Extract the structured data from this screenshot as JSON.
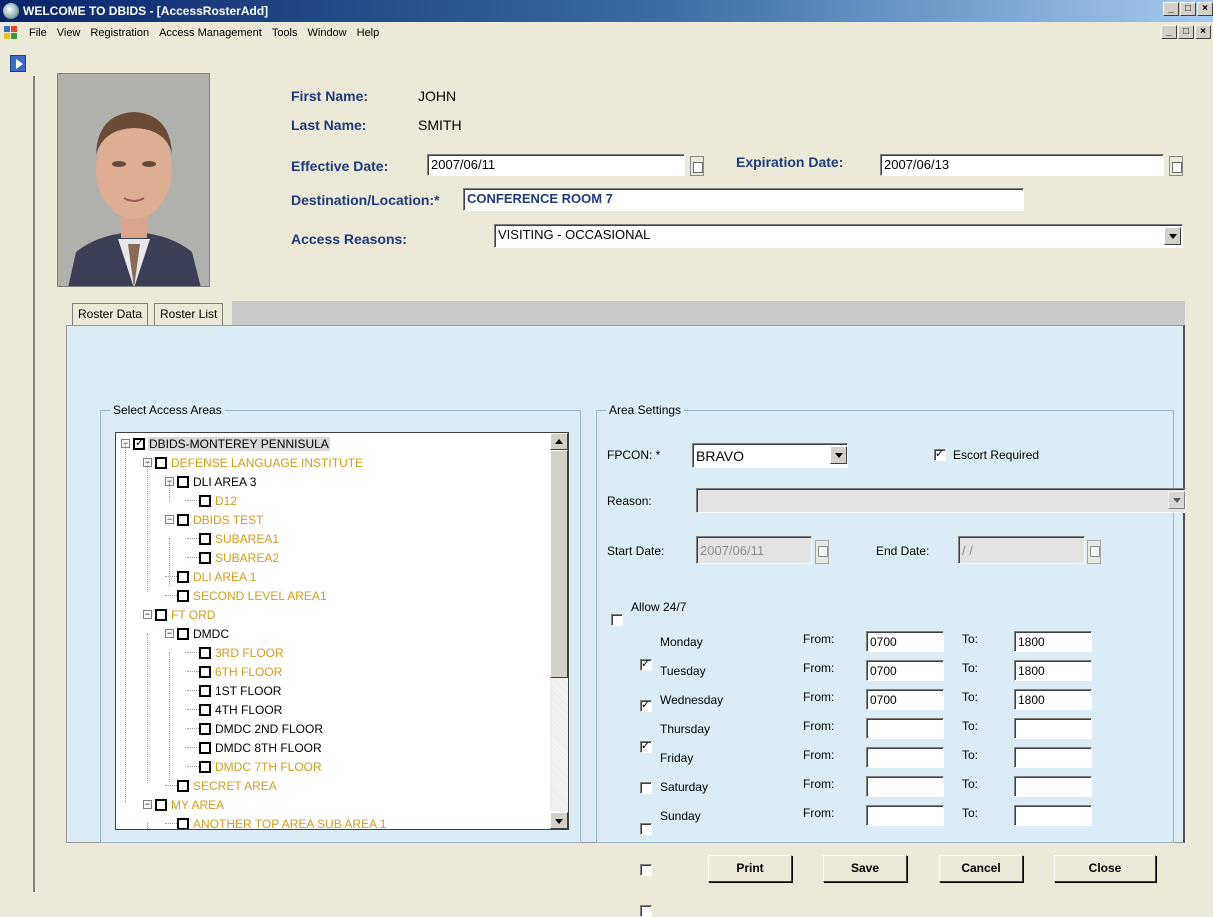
{
  "window": {
    "title": "WELCOME TO DBIDS - [AccessRosterAdd]",
    "controls": [
      "_",
      "□",
      "×"
    ]
  },
  "menu": {
    "items": [
      "File",
      "View",
      "Registration",
      "Access Management",
      "Tools",
      "Window",
      "Help"
    ]
  },
  "person": {
    "first_name_label": "First Name:",
    "first_name": "JOHN",
    "last_name_label": "Last Name:",
    "last_name": "SMITH"
  },
  "form": {
    "effective_date_label": "Effective Date:",
    "effective_date": "2007/06/11",
    "expiration_date_label": "Expiration Date:",
    "expiration_date": "2007/06/13",
    "destination_label": "Destination/Location:*",
    "destination": "CONFERENCE ROOM 7",
    "access_reasons_label": "Access Reasons:",
    "access_reason": "VISITING - OCCASIONAL"
  },
  "tabs": [
    "Roster Data",
    "Roster List"
  ],
  "tree_group_title": "Select Access Areas",
  "tree": [
    {
      "label": "DBIDS-MONTEREY PENNISULA",
      "level": 0,
      "checked": true,
      "expander": "−",
      "gold": false
    },
    {
      "label": "DEFENSE LANGUAGE INSTITUTE",
      "level": 1,
      "checked": false,
      "expander": "−",
      "gold": true
    },
    {
      "label": "DLI AREA 3",
      "level": 2,
      "checked": false,
      "expander": "−",
      "gold": false
    },
    {
      "label": "D12",
      "level": 3,
      "checked": false,
      "expander": "",
      "gold": true
    },
    {
      "label": "DBIDS TEST",
      "level": 2,
      "checked": false,
      "expander": "−",
      "gold": true
    },
    {
      "label": "SUBAREA1",
      "level": 3,
      "checked": false,
      "expander": "",
      "gold": true
    },
    {
      "label": "SUBAREA2",
      "level": 3,
      "checked": false,
      "expander": "",
      "gold": true
    },
    {
      "label": "DLI AREA 1",
      "level": 2,
      "checked": false,
      "expander": "",
      "gold": true
    },
    {
      "label": "SECOND LEVEL AREA1",
      "level": 2,
      "checked": false,
      "expander": "",
      "gold": true
    },
    {
      "label": "FT ORD",
      "level": 1,
      "checked": false,
      "expander": "−",
      "gold": true
    },
    {
      "label": "DMDC",
      "level": 2,
      "checked": false,
      "expander": "−",
      "gold": false
    },
    {
      "label": "3RD FLOOR",
      "level": 3,
      "checked": false,
      "expander": "",
      "gold": true
    },
    {
      "label": "6TH FLOOR",
      "level": 3,
      "checked": false,
      "expander": "",
      "gold": true
    },
    {
      "label": "1ST FLOOR",
      "level": 3,
      "checked": false,
      "expander": "",
      "gold": false
    },
    {
      "label": "4TH FLOOR",
      "level": 3,
      "checked": false,
      "expander": "",
      "gold": false
    },
    {
      "label": "DMDC 2ND FLOOR",
      "level": 3,
      "checked": false,
      "expander": "",
      "gold": false
    },
    {
      "label": "DMDC 8TH FLOOR",
      "level": 3,
      "checked": false,
      "expander": "",
      "gold": false
    },
    {
      "label": "DMDC 7TH FLOOR",
      "level": 3,
      "checked": false,
      "expander": "",
      "gold": true
    },
    {
      "label": "SECRET AREA",
      "level": 2,
      "checked": false,
      "expander": "",
      "gold": true
    },
    {
      "label": "MY AREA",
      "level": 1,
      "checked": false,
      "expander": "−",
      "gold": true
    },
    {
      "label": "ANOTHER TOP AREA SUB AREA 1",
      "level": 2,
      "checked": false,
      "expander": "",
      "gold": true
    }
  ],
  "settings": {
    "group_title": "Area Settings",
    "fpcon_label": "FPCON: *",
    "fpcon_value": "BRAVO",
    "escort_label": "Escort Required",
    "escort_checked": true,
    "reason_label": "Reason:",
    "reason_value": "",
    "start_date_label": "Start Date:",
    "start_date": "2007/06/11",
    "end_date_label": "End Date:",
    "end_date": " /  /",
    "allow247_label": "Allow 24/7",
    "allow247_checked": false,
    "from_label": "From:",
    "to_label": "To:"
  },
  "schedule": [
    {
      "day": "Monday",
      "checked": true,
      "from": "0700",
      "to": "1800"
    },
    {
      "day": "Tuesday",
      "checked": true,
      "from": "0700",
      "to": "1800"
    },
    {
      "day": "Wednesday",
      "checked": true,
      "from": "0700",
      "to": "1800"
    },
    {
      "day": "Thursday",
      "checked": false,
      "from": "",
      "to": ""
    },
    {
      "day": "Friday",
      "checked": false,
      "from": "",
      "to": ""
    },
    {
      "day": "Saturday",
      "checked": false,
      "from": "",
      "to": ""
    },
    {
      "day": "Sunday",
      "checked": false,
      "from": "",
      "to": ""
    }
  ],
  "buttons": {
    "print": "Print",
    "save": "Save",
    "cancel": "Cancel",
    "close": "Close"
  },
  "colors": {
    "label_blue": "#1f3a7a",
    "tree_gold": "#d49b1e",
    "panel_bg": "#dcecf6"
  }
}
